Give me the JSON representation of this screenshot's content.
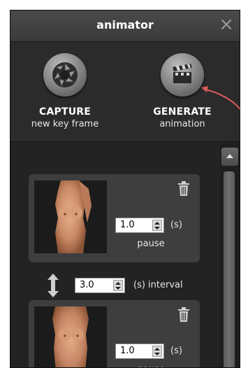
{
  "window": {
    "title": "animator",
    "close_symbol": "×"
  },
  "toolbar": {
    "capture": {
      "label": "CAPTURE",
      "sublabel": "new key frame",
      "icon": "camera-shutter-icon"
    },
    "generate": {
      "label": "GENERATE",
      "sublabel": "animation",
      "icon": "clapperboard-icon"
    }
  },
  "frames": [
    {
      "pause_value": "1.0",
      "unit": "(s)",
      "pause_label": "pause"
    },
    {
      "pause_value": "1.0",
      "unit": "(s)",
      "pause_label": "pause"
    }
  ],
  "interval": {
    "value": "3.0",
    "label": "(s) interval"
  },
  "annotation": {
    "color": "#e05a5a"
  },
  "colors": {
    "panel": "#2a2a2a",
    "card": "#3e3e3e",
    "titlebar": "#3a3a3a"
  }
}
